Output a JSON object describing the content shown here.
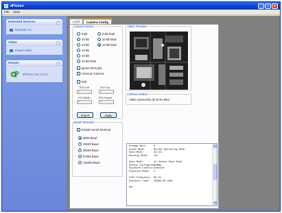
{
  "app": {
    "title": "dPiction"
  },
  "titlebar": {
    "min": "_",
    "max": "□",
    "close": "x"
  },
  "menu": [
    "File",
    "View"
  ],
  "sidebar": {
    "panels": [
      {
        "title": "Detected Devices",
        "item": "Nemesis CL"
      },
      {
        "title": "Video",
        "item": "Pause video"
      },
      {
        "title": "Details",
        "item": "dPiction Cue v.1.5.4"
      }
    ]
  },
  "tabs": [
    "Load",
    "Camera Config"
  ],
  "camera_setup": {
    "legend": "Camera Setup",
    "modes_left": [
      {
        "label": "8 Bit",
        "selected": false
      },
      {
        "label": "10 Bit",
        "selected": false
      },
      {
        "label": "12 Bit",
        "selected": false
      },
      {
        "label": "14 Bit",
        "selected": false
      },
      {
        "label": "16 Bit",
        "selected": false
      },
      {
        "label": "24 Bit RGB",
        "selected": false
      }
    ],
    "modes_right": [
      {
        "label": "8 Bit Dual",
        "selected": false
      },
      {
        "label": "10 Bit Dual",
        "selected": false
      },
      {
        "label": "12 Bit Dual",
        "selected": true
      }
    ],
    "options": [
      {
        "label": "Ignore DVAL(D)",
        "checked": false
      },
      {
        "label": "Unsecan Camera",
        "checked": false
      }
    ],
    "roi_check": "ROI",
    "roi_fields": [
      {
        "label": "ROI Left",
        "value": "0"
      },
      {
        "label": "ROI Top",
        "value": "0"
      },
      {
        "label": "ROI Width",
        "value": "0"
      },
      {
        "label": "ROI Height",
        "value": "0"
      }
    ],
    "import_label": "Import",
    "apply_label": "Apply"
  },
  "video_preview": {
    "legend": "Video Preview"
  },
  "camera_status": {
    "legend": "Camera Status",
    "text": "Video 1024x1024 @ 40.01 MHz"
  },
  "serial": {
    "legend": "Serial Terminal",
    "enable_label": "Enable Serial Terminal",
    "bauds": [
      {
        "label": "9600 Baud",
        "selected": true
      },
      {
        "label": "19200 Baud",
        "selected": false
      },
      {
        "label": "38400 Baud",
        "selected": false
      },
      {
        "label": "57600 Baud",
        "selected": false
      },
      {
        "label": "115200 Baud",
        "selected": false
      }
    ]
  },
  "log": {
    "lines": [
      {
        "k": "Preamp Gain",
        "v": "0"
      },
      {
        "k": "Video Mode:",
        "v": "Normal Operating Mode"
      },
      {
        "k": "Data Mode:",
        "v": "12 bit"
      },
      {
        "k": "Binning Mode:",
        "v": "1x1"
      },
      {
        "k": "",
        "v": ""
      },
      {
        "k": "Gain Mode:",
        "v": "1x Output Gain Mode"
      },
      {
        "k": "Output Configuration:",
        "v": "2 Tap"
      },
      {
        "k": "Exposure Control:",
        "v": "enabled"
      },
      {
        "k": "Exposure Mode:",
        "v": "2"
      },
      {
        "k": "",
        "v": ""
      },
      {
        "k": "PIXC Frequency:",
        "v": "90 Hz"
      },
      {
        "k": "Exposure Time:",
        "v": "16000.00 uSec"
      },
      {
        "k": "",
        "v": ""
      },
      {
        "k": "OK>",
        "v": ""
      }
    ]
  },
  "colors": {
    "accent": "#215dc6",
    "titlebar": "#0a3fd0",
    "selected_radio": "#21a121"
  }
}
